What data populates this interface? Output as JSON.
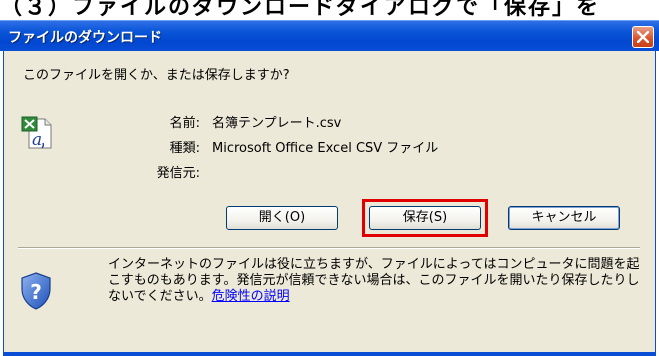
{
  "top_caption": "（３）ファイルのダウンロードダイアログで「保存」を",
  "window": {
    "title": "ファイルのダウンロード",
    "close_icon": "close-x-icon"
  },
  "dialog": {
    "question": "このファイルを開くか、または保存しますか?",
    "file_icon": "excel-csv-file-icon",
    "info": {
      "name_label": "名前:",
      "name_value": "名簿テンプレート.csv",
      "type_label": "種類:",
      "type_value": "Microsoft Office Excel CSV ファイル",
      "from_label": "発信元:",
      "from_value": ""
    },
    "buttons": {
      "open": "開く(O)",
      "save": "保存(S)",
      "cancel": "キャンセル"
    },
    "highlight_color": "#e00000",
    "warning": {
      "icon": "security-shield-icon",
      "text": "インターネットのファイルは役に立ちますが、ファイルによってはコンピュータに問題を起こすものもあります。発信元が信頼できない場合は、このファイルを開いたり保存したりしないでください。",
      "link": "危険性の説明"
    }
  }
}
